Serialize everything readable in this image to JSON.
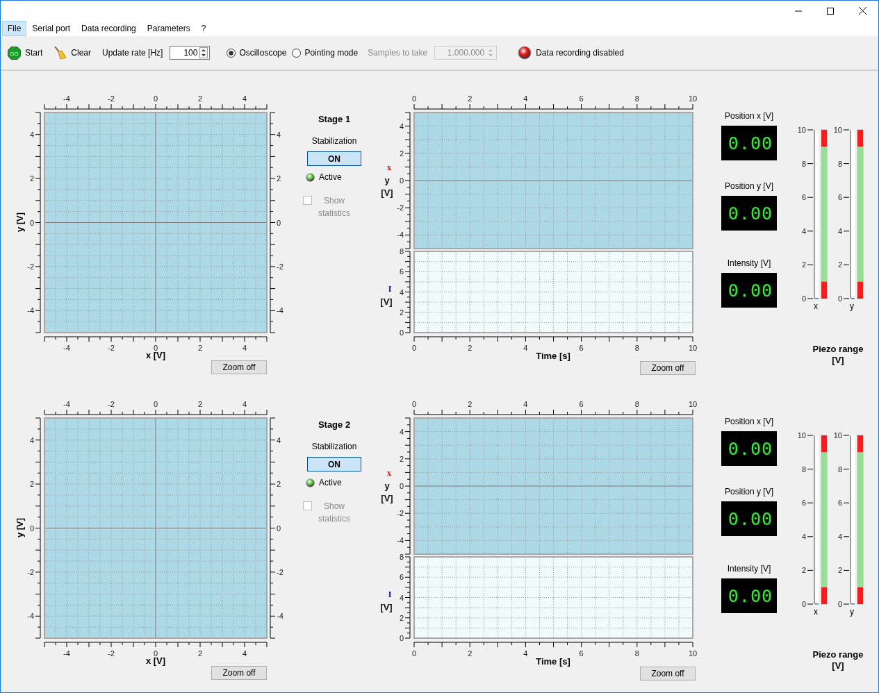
{
  "menu": [
    {
      "label": "File",
      "selected": true
    },
    {
      "label": "Serial port",
      "selected": false
    },
    {
      "label": "Data recording",
      "selected": false
    },
    {
      "label": "Parameters",
      "selected": false
    },
    {
      "label": "?",
      "selected": false
    }
  ],
  "toolbar": {
    "start": {
      "icon_text": "GO",
      "label": "Start"
    },
    "clear": {
      "label": "Clear"
    },
    "update_rate": {
      "label": "Update rate [Hz]",
      "value": "100"
    },
    "modes": [
      {
        "label": "Oscilloscope",
        "selected": true
      },
      {
        "label": "Pointing mode",
        "selected": false
      }
    ],
    "samples": {
      "label": "Samples to take",
      "value": "1.000.000",
      "disabled": true
    },
    "recording": {
      "label": "Data recording disabled",
      "on": false
    }
  },
  "stages": [
    {
      "title": "Stage 1",
      "xy_plot": {
        "top_axis_ticks": [
          "-4",
          "-2",
          "0",
          "2",
          "4"
        ],
        "right_axis_ticks": [
          "4",
          "2",
          "0",
          "-2",
          "-4"
        ],
        "bottom_axis_ticks": [
          "-4",
          "-2",
          "0",
          "2",
          "4"
        ],
        "left_axis_ticks": [
          "4",
          "2",
          "0",
          "-2",
          "-4"
        ],
        "chart_data": {
          "type": "scatter",
          "xlabel": "x [V]",
          "ylabel": "y [V]",
          "xlim": [
            -5,
            5
          ],
          "ylim": [
            -5,
            5
          ],
          "xticks": [
            -4,
            -2,
            0,
            2,
            4
          ],
          "yticks": [
            -4,
            -2,
            0,
            2,
            4
          ],
          "grid": true
        },
        "zoom_button": "Zoom off"
      },
      "stabilization": {
        "label": "Stabilization",
        "button": "ON",
        "on": true
      },
      "active": {
        "label": "Active",
        "on": true
      },
      "statistics": {
        "label": "Show statistics",
        "checked": false,
        "disabled": true
      },
      "position_plot": {
        "legend": {
          "text": "x",
          "color": "#ff0000"
        },
        "top_axis_ticks": [
          "0",
          "2",
          "4",
          "6",
          "8",
          "10"
        ],
        "chart_data": {
          "type": "line",
          "ylabel": "y [V]",
          "xlim": [
            0,
            10
          ],
          "ylim": [
            -5,
            5
          ],
          "xticks": [
            0,
            2,
            4,
            6,
            8,
            10
          ],
          "yticks": [
            -4,
            -2,
            0,
            2,
            4
          ],
          "grid": true
        }
      },
      "intensity_plot": {
        "legend": {
          "text": "I",
          "color": "#0000ff"
        },
        "chart_data": {
          "type": "line",
          "xlabel": "Time [s]",
          "ylabel": "[V]",
          "xlim": [
            0,
            10
          ],
          "ylim": [
            0,
            8
          ],
          "xticks": [
            0,
            2,
            4,
            6,
            8,
            10
          ],
          "yticks": [
            0,
            2,
            4,
            6,
            8
          ],
          "grid": true
        },
        "zoom_button": "Zoom off"
      },
      "readouts": [
        {
          "label": "Position x [V]",
          "value": "0.00"
        },
        {
          "label": "Position y [V]",
          "value": "0.00"
        },
        {
          "label": "Intensity [V]",
          "value": "0.00"
        }
      ],
      "piezo": {
        "bars": [
          {
            "label": "x",
            "level": 0,
            "ticks": [
              "10",
              "8",
              "6",
              "4",
              "2",
              "0"
            ]
          },
          {
            "label": "y",
            "level": 0,
            "ticks": [
              "10",
              "8",
              "6",
              "4",
              "2",
              "0"
            ]
          }
        ],
        "title": "Piezo range [V]"
      }
    },
    {
      "title": "Stage 2",
      "xy_plot": {
        "top_axis_ticks": [
          "-4",
          "-2",
          "0",
          "2",
          "4"
        ],
        "right_axis_ticks": [
          "4",
          "2",
          "0",
          "-2",
          "-4"
        ],
        "bottom_axis_ticks": [
          "-4",
          "-2",
          "0",
          "2",
          "4"
        ],
        "left_axis_ticks": [
          "4",
          "2",
          "0",
          "-2",
          "-4"
        ],
        "chart_data": {
          "type": "scatter",
          "xlabel": "x [V]",
          "ylabel": "y [V]",
          "xlim": [
            -5,
            5
          ],
          "ylim": [
            -5,
            5
          ],
          "xticks": [
            -4,
            -2,
            0,
            2,
            4
          ],
          "yticks": [
            -4,
            -2,
            0,
            2,
            4
          ],
          "grid": true
        },
        "zoom_button": "Zoom off"
      },
      "stabilization": {
        "label": "Stabilization",
        "button": "ON",
        "on": true
      },
      "active": {
        "label": "Active",
        "on": true
      },
      "statistics": {
        "label": "Show statistics",
        "checked": false,
        "disabled": true
      },
      "position_plot": {
        "legend": {
          "text": "x",
          "color": "#ff0000"
        },
        "top_axis_ticks": [
          "0",
          "2",
          "4",
          "6",
          "8",
          "10"
        ],
        "chart_data": {
          "type": "line",
          "ylabel": "y [V]",
          "xlim": [
            0,
            10
          ],
          "ylim": [
            -5,
            5
          ],
          "xticks": [
            0,
            2,
            4,
            6,
            8,
            10
          ],
          "yticks": [
            -4,
            -2,
            0,
            2,
            4
          ],
          "grid": true
        }
      },
      "intensity_plot": {
        "legend": {
          "text": "I",
          "color": "#0000ff"
        },
        "chart_data": {
          "type": "line",
          "xlabel": "Time [s]",
          "ylabel": "[V]",
          "xlim": [
            0,
            10
          ],
          "ylim": [
            0,
            8
          ],
          "xticks": [
            0,
            2,
            4,
            6,
            8,
            10
          ],
          "yticks": [
            0,
            2,
            4,
            6,
            8
          ],
          "grid": true
        },
        "zoom_button": "Zoom off"
      },
      "readouts": [
        {
          "label": "Position x [V]",
          "value": "0.00"
        },
        {
          "label": "Position y [V]",
          "value": "0.00"
        },
        {
          "label": "Intensity [V]",
          "value": "0.00"
        }
      ],
      "piezo": {
        "bars": [
          {
            "label": "x",
            "level": 0,
            "ticks": [
              "10",
              "8",
              "6",
              "4",
              "2",
              "0"
            ]
          },
          {
            "label": "y",
            "level": 0,
            "ticks": [
              "10",
              "8",
              "6",
              "4",
              "2",
              "0"
            ]
          }
        ],
        "title": "Piezo range [V]"
      }
    }
  ]
}
